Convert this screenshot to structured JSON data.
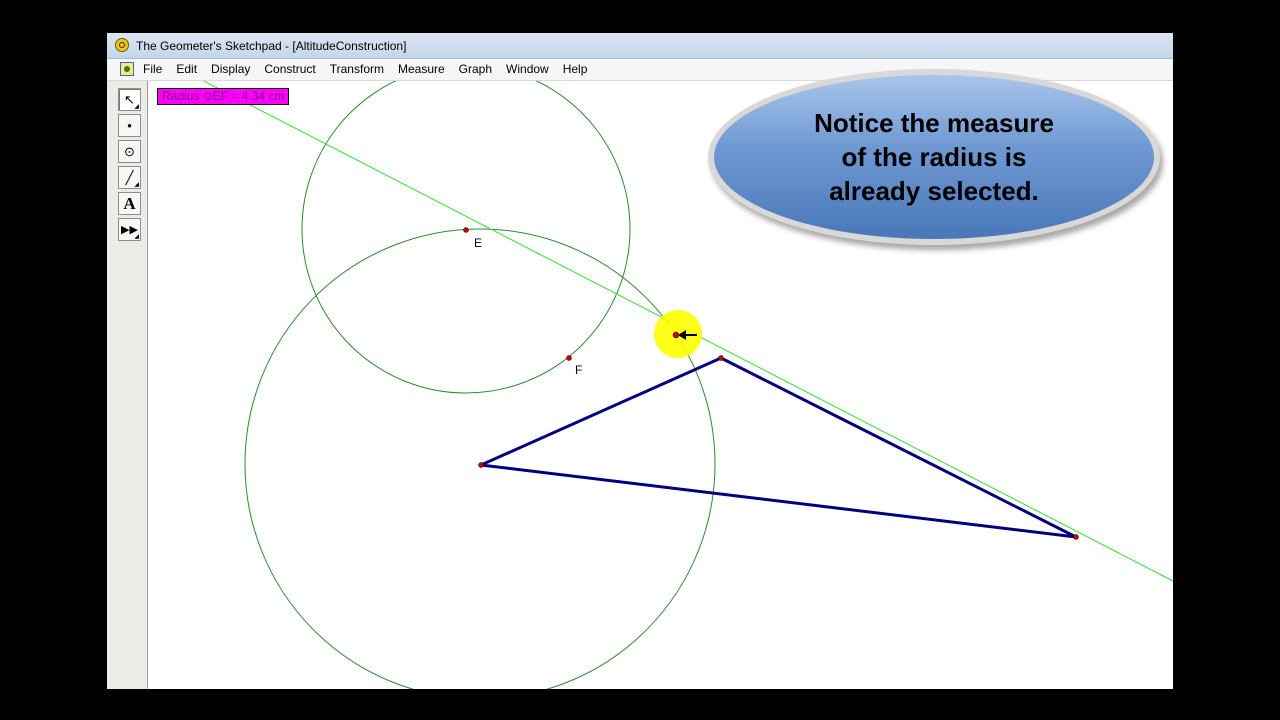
{
  "window": {
    "title": "The Geometer's Sketchpad - [AltitudeConstruction]",
    "app_icon": "sketchpad-app-icon",
    "doc_icon": "sketch-document-icon"
  },
  "menu": [
    "File",
    "Edit",
    "Display",
    "Construct",
    "Transform",
    "Measure",
    "Graph",
    "Window",
    "Help"
  ],
  "toolbox": [
    {
      "name": "arrow-tool",
      "glyph": "↖",
      "selected": true
    },
    {
      "name": "point-tool",
      "glyph": "•",
      "selected": false
    },
    {
      "name": "compass-tool",
      "glyph": "⊙",
      "selected": false
    },
    {
      "name": "straightedge-tool",
      "glyph": "╱",
      "selected": false
    },
    {
      "name": "text-tool",
      "glyph": "A",
      "selected": false
    },
    {
      "name": "custom-tool",
      "glyph": "⏩",
      "selected": false
    }
  ],
  "sketch": {
    "radius_measurement": "Radius ⊙EF = 4.34 cm",
    "point_labels": {
      "e": "E",
      "f": "F"
    },
    "colors": {
      "circle": "#2e8b2e",
      "line": "#33dd33",
      "triangle": "#000080",
      "point": "#cc0000",
      "highlight": "#ffff00",
      "measurement_bg": "#ff00ff"
    }
  },
  "callout": {
    "lines": [
      "Notice the measure",
      "of the radius is",
      "already selected."
    ]
  }
}
